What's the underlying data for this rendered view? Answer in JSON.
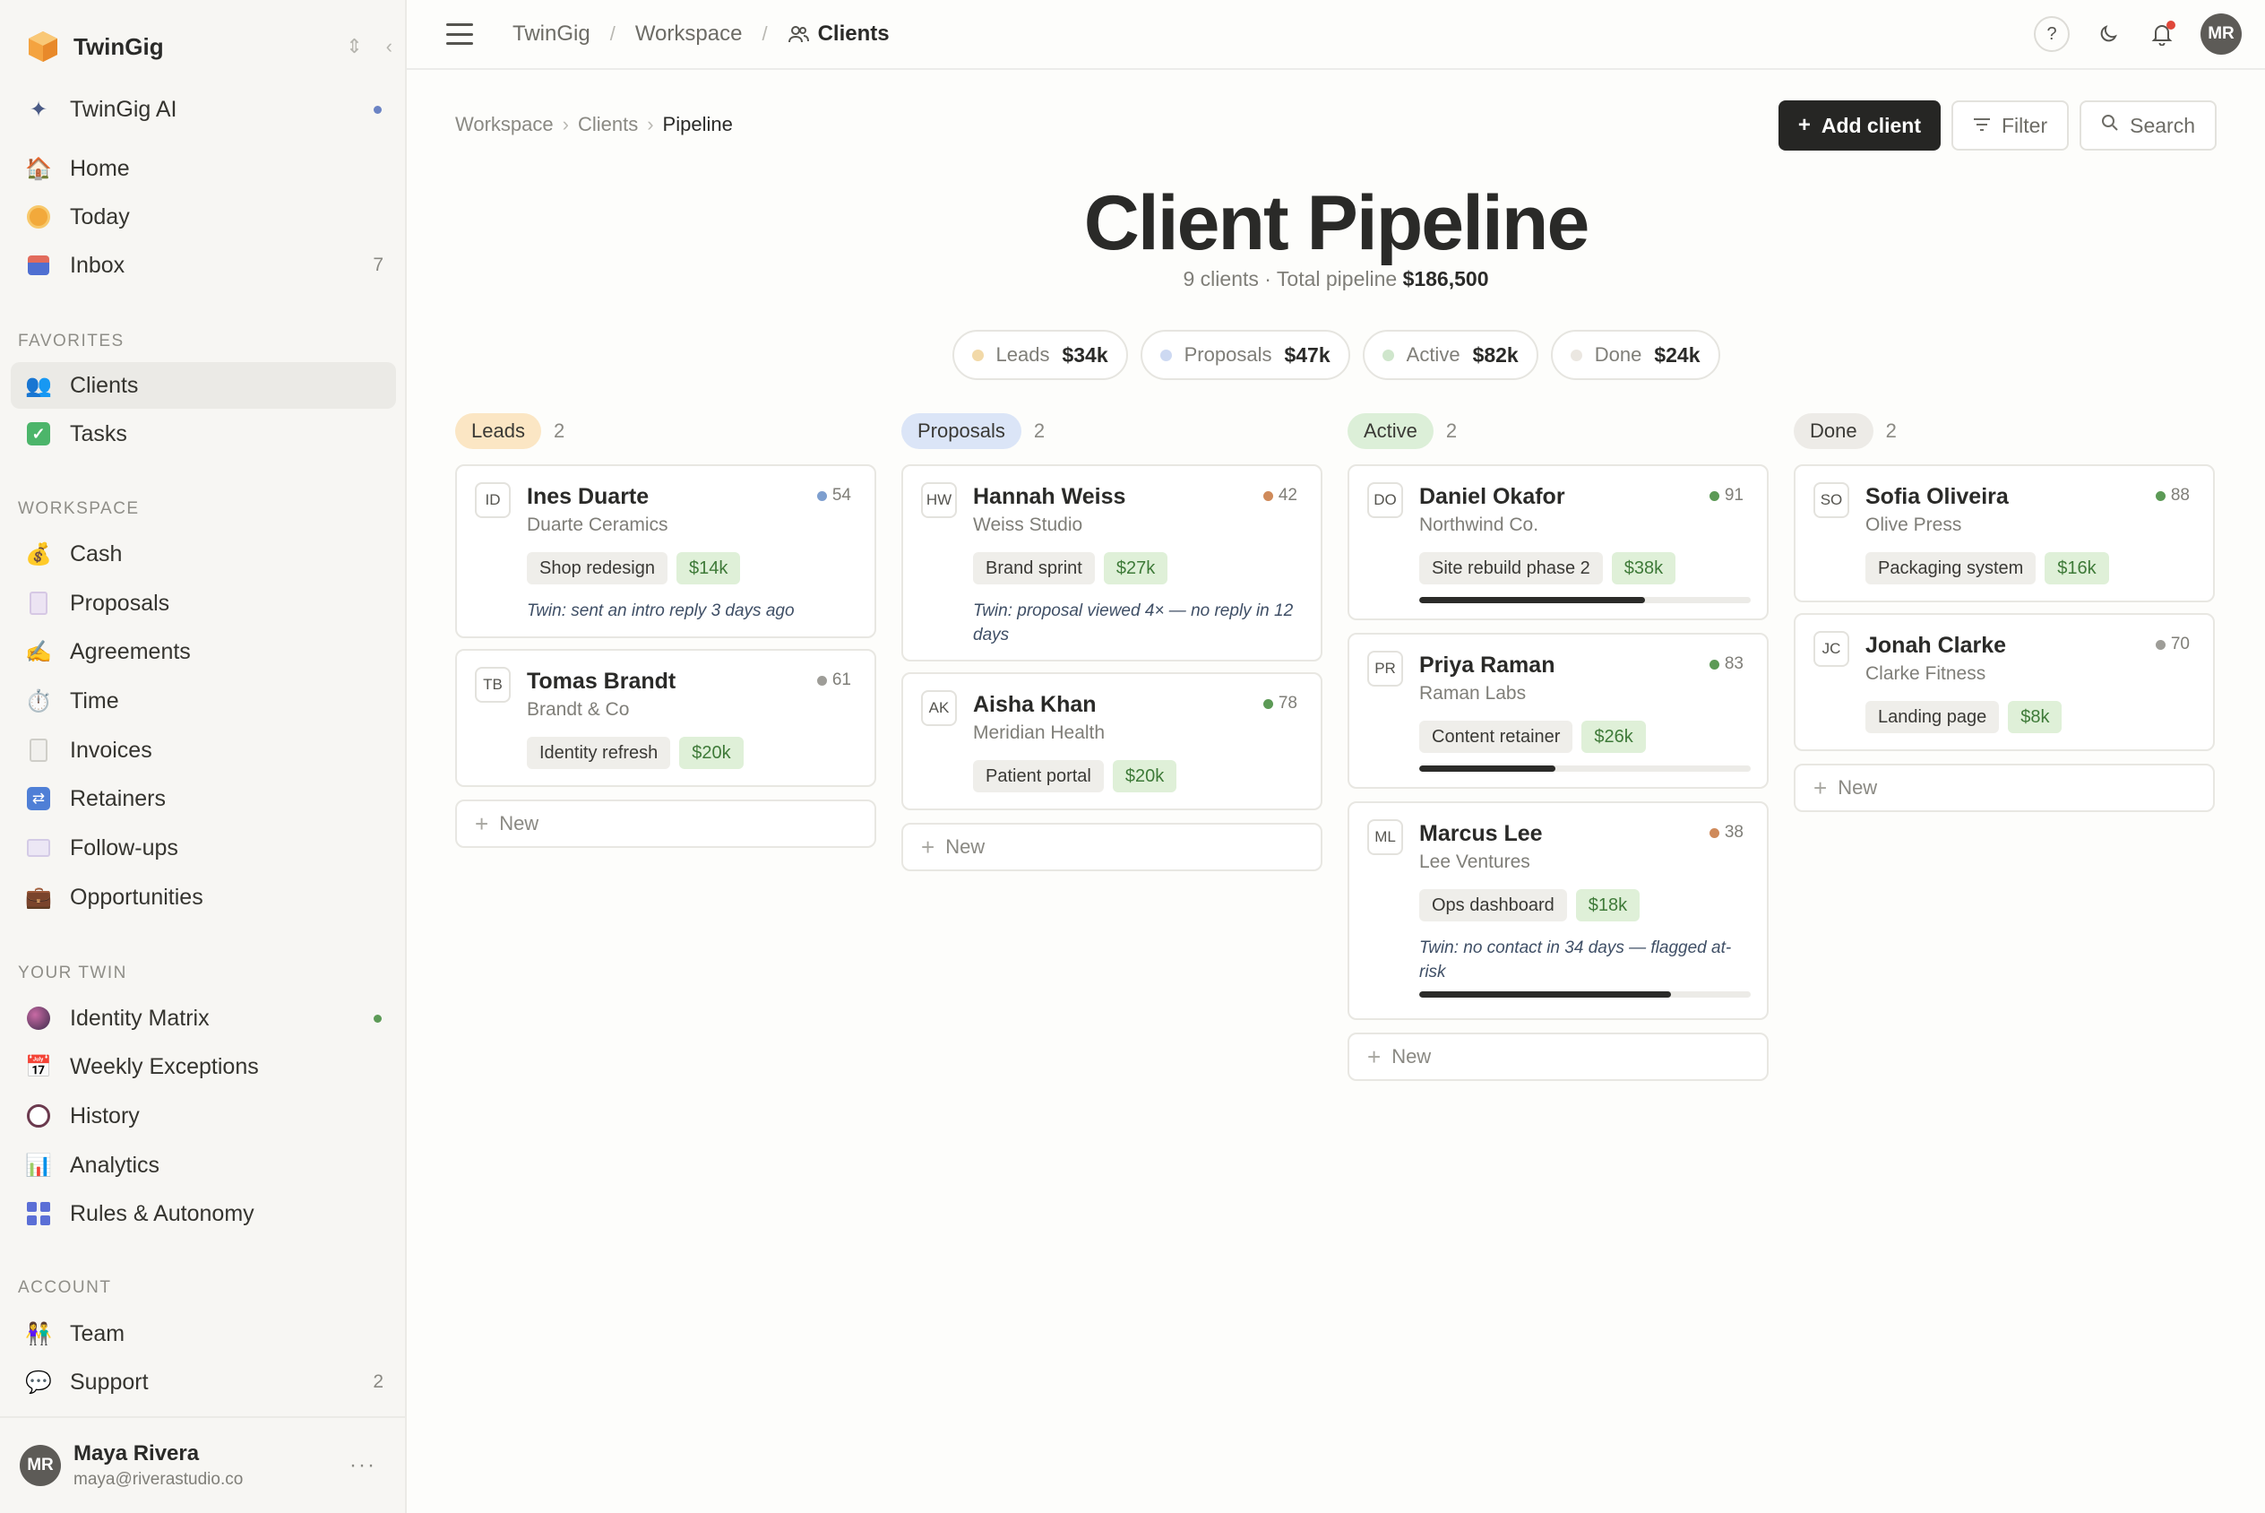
{
  "sidebar": {
    "workspace_name": "TwinGig",
    "ai_label": "TwinGig AI",
    "main_items": [
      {
        "label": "Home",
        "count": ""
      },
      {
        "label": "Today",
        "count": ""
      },
      {
        "label": "Inbox",
        "count": "7"
      }
    ],
    "favorites_label": "FAVORITES",
    "favorites": [
      {
        "label": "Clients"
      },
      {
        "label": "Tasks"
      }
    ],
    "workspace_label": "WORKSPACE",
    "workspace_items": [
      {
        "label": "Cash"
      },
      {
        "label": "Proposals"
      },
      {
        "label": "Agreements"
      },
      {
        "label": "Time"
      },
      {
        "label": "Invoices"
      },
      {
        "label": "Retainers"
      },
      {
        "label": "Follow-ups"
      },
      {
        "label": "Opportunities"
      }
    ],
    "twin_label": "YOUR TWIN",
    "twin_items": [
      {
        "label": "Identity Matrix"
      },
      {
        "label": "Weekly Exceptions"
      },
      {
        "label": "History"
      },
      {
        "label": "Analytics"
      },
      {
        "label": "Rules & Autonomy"
      }
    ],
    "account_label": "ACCOUNT",
    "account_items": [
      {
        "label": "Team",
        "count": ""
      },
      {
        "label": "Support",
        "count": "2"
      }
    ],
    "user": {
      "initials": "MR",
      "name": "Maya Rivera",
      "email": "maya@riverastudio.co"
    }
  },
  "topbar": {
    "crumbs": [
      "TwinGig",
      "Workspace",
      "Clients"
    ],
    "avatar_initials": "MR"
  },
  "page": {
    "subcrumbs": [
      "Workspace",
      "Clients",
      "Pipeline"
    ],
    "add_client": "Add client",
    "filter": "Filter",
    "search": "Search",
    "title": "Client Pipeline",
    "subtitle_prefix": "9 clients · Total pipeline",
    "subtitle_total": "$186,500"
  },
  "summary": [
    {
      "label": "Leads",
      "value": "$34k",
      "color": "#f2d9a8"
    },
    {
      "label": "Proposals",
      "value": "$47k",
      "color": "#cdd9f2"
    },
    {
      "label": "Active",
      "value": "$82k",
      "color": "#cfe6cc"
    },
    {
      "label": "Done",
      "value": "$24k",
      "color": "#ebe7e1"
    }
  ],
  "columns": [
    {
      "label": "Leads",
      "count": "2",
      "tag_color": "#fbe6c4",
      "cards": [
        {
          "initials": "ID",
          "name": "Ines Duarte",
          "company": "Duarte Ceramics",
          "score": "54",
          "score_color": "#7e9fcf",
          "project": "Shop redesign",
          "value": "$14k",
          "note": "Twin: sent an intro reply 3 days ago"
        },
        {
          "initials": "TB",
          "name": "Tomas Brandt",
          "company": "Brandt & Co",
          "score": "61",
          "score_color": "#9e9d98",
          "project": "Identity refresh",
          "value": "$20k"
        }
      ],
      "new_label": "New"
    },
    {
      "label": "Proposals",
      "count": "2",
      "tag_color": "#dbe5f7",
      "cards": [
        {
          "initials": "HW",
          "name": "Hannah Weiss",
          "company": "Weiss Studio",
          "score": "42",
          "score_color": "#cf8a5a",
          "project": "Brand sprint",
          "value": "$27k",
          "note": "Twin: proposal viewed 4× — no reply in 12 days"
        },
        {
          "initials": "AK",
          "name": "Aisha Khan",
          "company": "Meridian Health",
          "score": "78",
          "score_color": "#5c9a56",
          "project": "Patient portal",
          "value": "$20k"
        }
      ],
      "new_label": "New"
    },
    {
      "label": "Active",
      "count": "2",
      "tag_color": "#dcefd8",
      "cards": [
        {
          "initials": "DO",
          "name": "Daniel Okafor",
          "company": "Northwind Co.",
          "score": "91",
          "score_color": "#5c9a56",
          "project": "Site rebuild phase 2",
          "value": "$38k",
          "progress": 0.68
        },
        {
          "initials": "PR",
          "name": "Priya Raman",
          "company": "Raman Labs",
          "score": "83",
          "score_color": "#5c9a56",
          "project": "Content retainer",
          "value": "$26k",
          "progress": 0.41
        },
        {
          "initials": "ML",
          "name": "Marcus Lee",
          "company": "Lee Ventures",
          "score": "38",
          "score_color": "#cf8a5a",
          "project": "Ops dashboard",
          "value": "$18k",
          "note": "Twin: no contact in 34 days — flagged at-risk",
          "progress": 0.76
        }
      ],
      "new_label": "New"
    },
    {
      "label": "Done",
      "count": "2",
      "tag_color": "#edebe7",
      "cards": [
        {
          "initials": "SO",
          "name": "Sofia Oliveira",
          "company": "Olive Press",
          "score": "88",
          "score_color": "#5c9a56",
          "project": "Packaging system",
          "value": "$16k"
        },
        {
          "initials": "JC",
          "name": "Jonah Clarke",
          "company": "Clarke Fitness",
          "score": "70",
          "score_color": "#9e9d98",
          "project": "Landing page",
          "value": "$8k"
        }
      ],
      "new_label": "New"
    }
  ]
}
